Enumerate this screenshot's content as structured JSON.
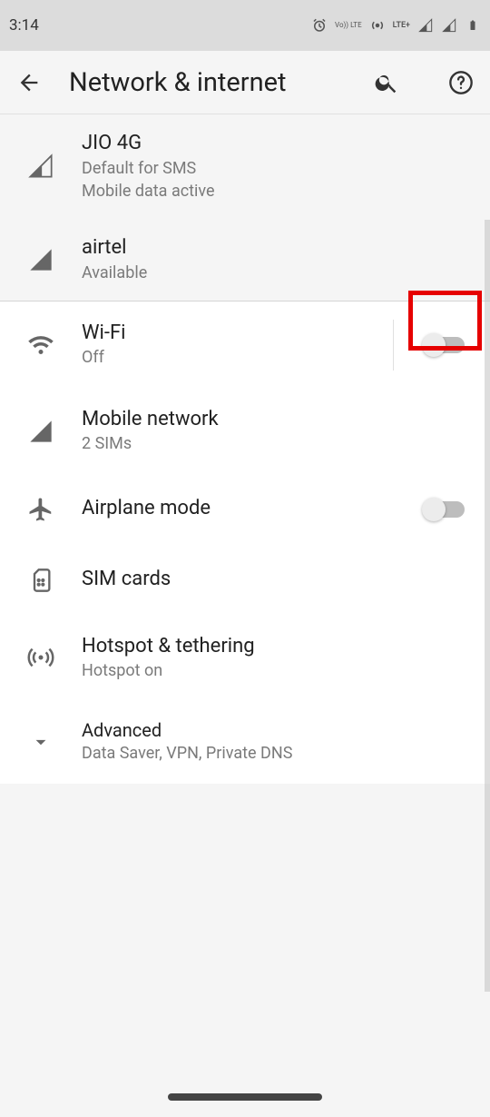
{
  "status": {
    "time": "3:14",
    "lte_label": "LTE+",
    "volte_label": "Vo)) LTE"
  },
  "appbar": {
    "title": "Network & internet"
  },
  "sims": [
    {
      "name": "JIO 4G",
      "line1": "Default for SMS",
      "line2": "Mobile data active"
    },
    {
      "name": "airtel",
      "line1": "Available"
    }
  ],
  "rows": {
    "wifi": {
      "title": "Wi-Fi",
      "subtitle": "Off",
      "toggle": false
    },
    "mobile": {
      "title": "Mobile network",
      "subtitle": "2 SIMs"
    },
    "airplane": {
      "title": "Airplane mode",
      "toggle": false
    },
    "sim_cards": {
      "title": "SIM cards"
    },
    "hotspot": {
      "title": "Hotspot & tethering",
      "subtitle": "Hotspot on"
    },
    "advanced": {
      "title": "Advanced",
      "subtitle": "Data Saver, VPN, Private DNS"
    }
  }
}
